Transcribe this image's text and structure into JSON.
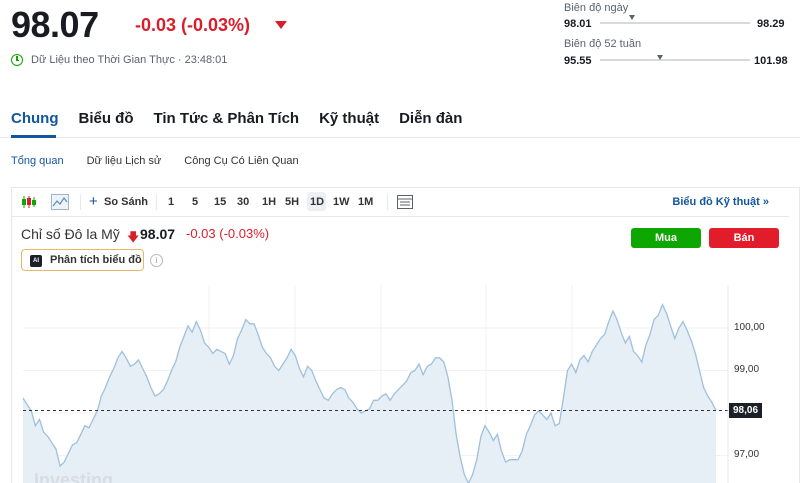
{
  "header": {
    "price": "98.07",
    "change": "-0.03 (-0.03%)",
    "realtime": "Dữ Liệu theo Thời Gian Thực · 23:48:01"
  },
  "ranges": {
    "day_label": "Biên độ ngày",
    "day_low": "98.01",
    "day_high": "98.29",
    "week52_label": "Biên độ 52 tuần",
    "week52_low": "95.55",
    "week52_high": "101.98"
  },
  "tabs": [
    "Chung",
    "Biểu đồ",
    "Tin Tức & Phân Tích",
    "Kỹ thuật",
    "Diễn đàn"
  ],
  "subtabs": [
    "Tổng quan",
    "Dữ liệu Lịch sử",
    "Công Cụ Có Liên Quan"
  ],
  "toolbar": {
    "compare": "So Sánh",
    "intervals": [
      "1",
      "5",
      "15",
      "30",
      "1H",
      "5H",
      "1D",
      "1W",
      "1M"
    ],
    "technical_link": "Biểu đồ Kỹ thuật"
  },
  "chart_header": {
    "title": "Chỉ số Đô la Mỹ",
    "price": "98.07",
    "change": "-0.03 (-0.03%)",
    "buy": "Mua",
    "sell": "Bán",
    "ai_badge": "AI",
    "ai_label": "Phân tích biểu đồ",
    "info": "i"
  },
  "watermark": "Investing",
  "colors": {
    "up": "#0ea600",
    "down": "#d91e2b",
    "accent": "#1256a0",
    "line": "#9fc0dc",
    "fill": "#e6eef6"
  },
  "chart_data": {
    "type": "area",
    "y_tick_labels": [
      "100,00",
      "99,00",
      "98,00",
      "97,00"
    ],
    "y_ticks": [
      100,
      99,
      98,
      97
    ],
    "last_value_label": "98,06",
    "last_value": 98.06,
    "ylim": [
      96.25,
      100.8
    ],
    "y_values": [
      98.35,
      98.2,
      98.05,
      97.7,
      97.85,
      97.55,
      97.45,
      97.3,
      97.15,
      96.75,
      96.85,
      97.05,
      97.25,
      97.3,
      97.5,
      97.7,
      97.65,
      97.85,
      98.05,
      98.4,
      98.6,
      98.85,
      99.05,
      99.3,
      99.45,
      99.3,
      99.1,
      99.15,
      99.25,
      99.05,
      98.85,
      98.6,
      98.4,
      98.45,
      98.55,
      98.75,
      99.0,
      99.2,
      99.55,
      99.8,
      100.05,
      99.9,
      100.15,
      99.95,
      99.65,
      99.55,
      99.4,
      99.5,
      99.45,
      99.4,
      99.15,
      99.35,
      99.75,
      99.95,
      100.2,
      100.1,
      100.1,
      99.85,
      99.55,
      99.4,
      99.3,
      99.1,
      99.0,
      99.15,
      99.3,
      99.5,
      99.35,
      99.05,
      98.85,
      99.1,
      99.0,
      98.75,
      98.55,
      98.35,
      98.3,
      98.45,
      98.55,
      98.6,
      98.55,
      98.35,
      98.25,
      98.1,
      98.0,
      98.05,
      98.1,
      98.3,
      98.3,
      98.4,
      98.45,
      98.3,
      98.45,
      98.55,
      98.65,
      98.75,
      98.95,
      99.0,
      99.15,
      98.9,
      99.1,
      99.15,
      99.3,
      99.3,
      99.2,
      98.85,
      98.3,
      97.5,
      96.95,
      96.55,
      96.35,
      96.55,
      96.9,
      97.45,
      97.7,
      97.55,
      97.35,
      97.5,
      97.1,
      96.85,
      96.9,
      96.9,
      96.9,
      97.1,
      97.5,
      97.7,
      97.95,
      98.05,
      97.95,
      97.85,
      98.0,
      97.7,
      97.75,
      98.35,
      99.0,
      99.15,
      98.95,
      99.25,
      99.35,
      99.2,
      99.45,
      99.6,
      99.75,
      99.85,
      100.15,
      100.4,
      100.2,
      99.9,
      99.65,
      99.8,
      99.45,
      99.35,
      99.2,
      99.6,
      99.85,
      100.2,
      100.3,
      100.55,
      100.35,
      100.05,
      99.75,
      100.0,
      100.15,
      99.95,
      99.7,
      99.4,
      99.0,
      98.6,
      98.4,
      98.25,
      98.06
    ]
  }
}
